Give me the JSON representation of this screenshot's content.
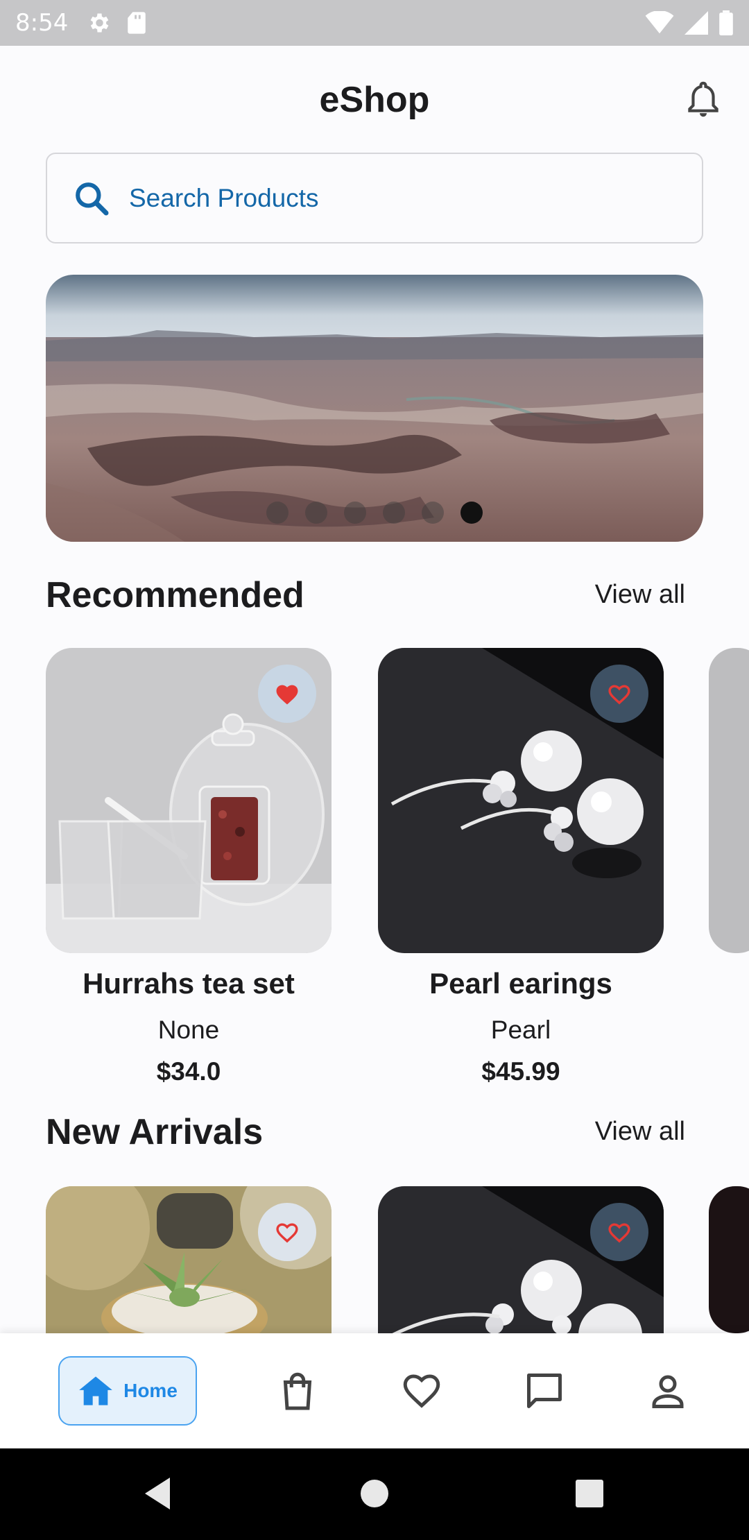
{
  "status_bar": {
    "time": "8:54"
  },
  "app_bar": {
    "title": "eShop"
  },
  "search": {
    "placeholder": "Search Products"
  },
  "banner": {
    "dots_total": 6,
    "active_index": 5
  },
  "recommended": {
    "title": "Recommended",
    "view_all": "View all",
    "products": [
      {
        "name": "Hurrahs tea set",
        "category": "None",
        "price": "$34.0",
        "favorited": true
      },
      {
        "name": "Pearl earings",
        "category": "Pearl",
        "price": "$45.99",
        "favorited": false
      }
    ]
  },
  "new_arrivals": {
    "title": "New Arrivals",
    "view_all": "View all"
  },
  "bottom_nav": {
    "home_label": "Home",
    "items": [
      "home-icon",
      "shopping-bag-icon",
      "heart-icon",
      "chat-icon",
      "profile-icon"
    ]
  },
  "colors": {
    "accent": "#1e88e5",
    "search_text": "#1467a8",
    "favorite": "#e53935"
  }
}
